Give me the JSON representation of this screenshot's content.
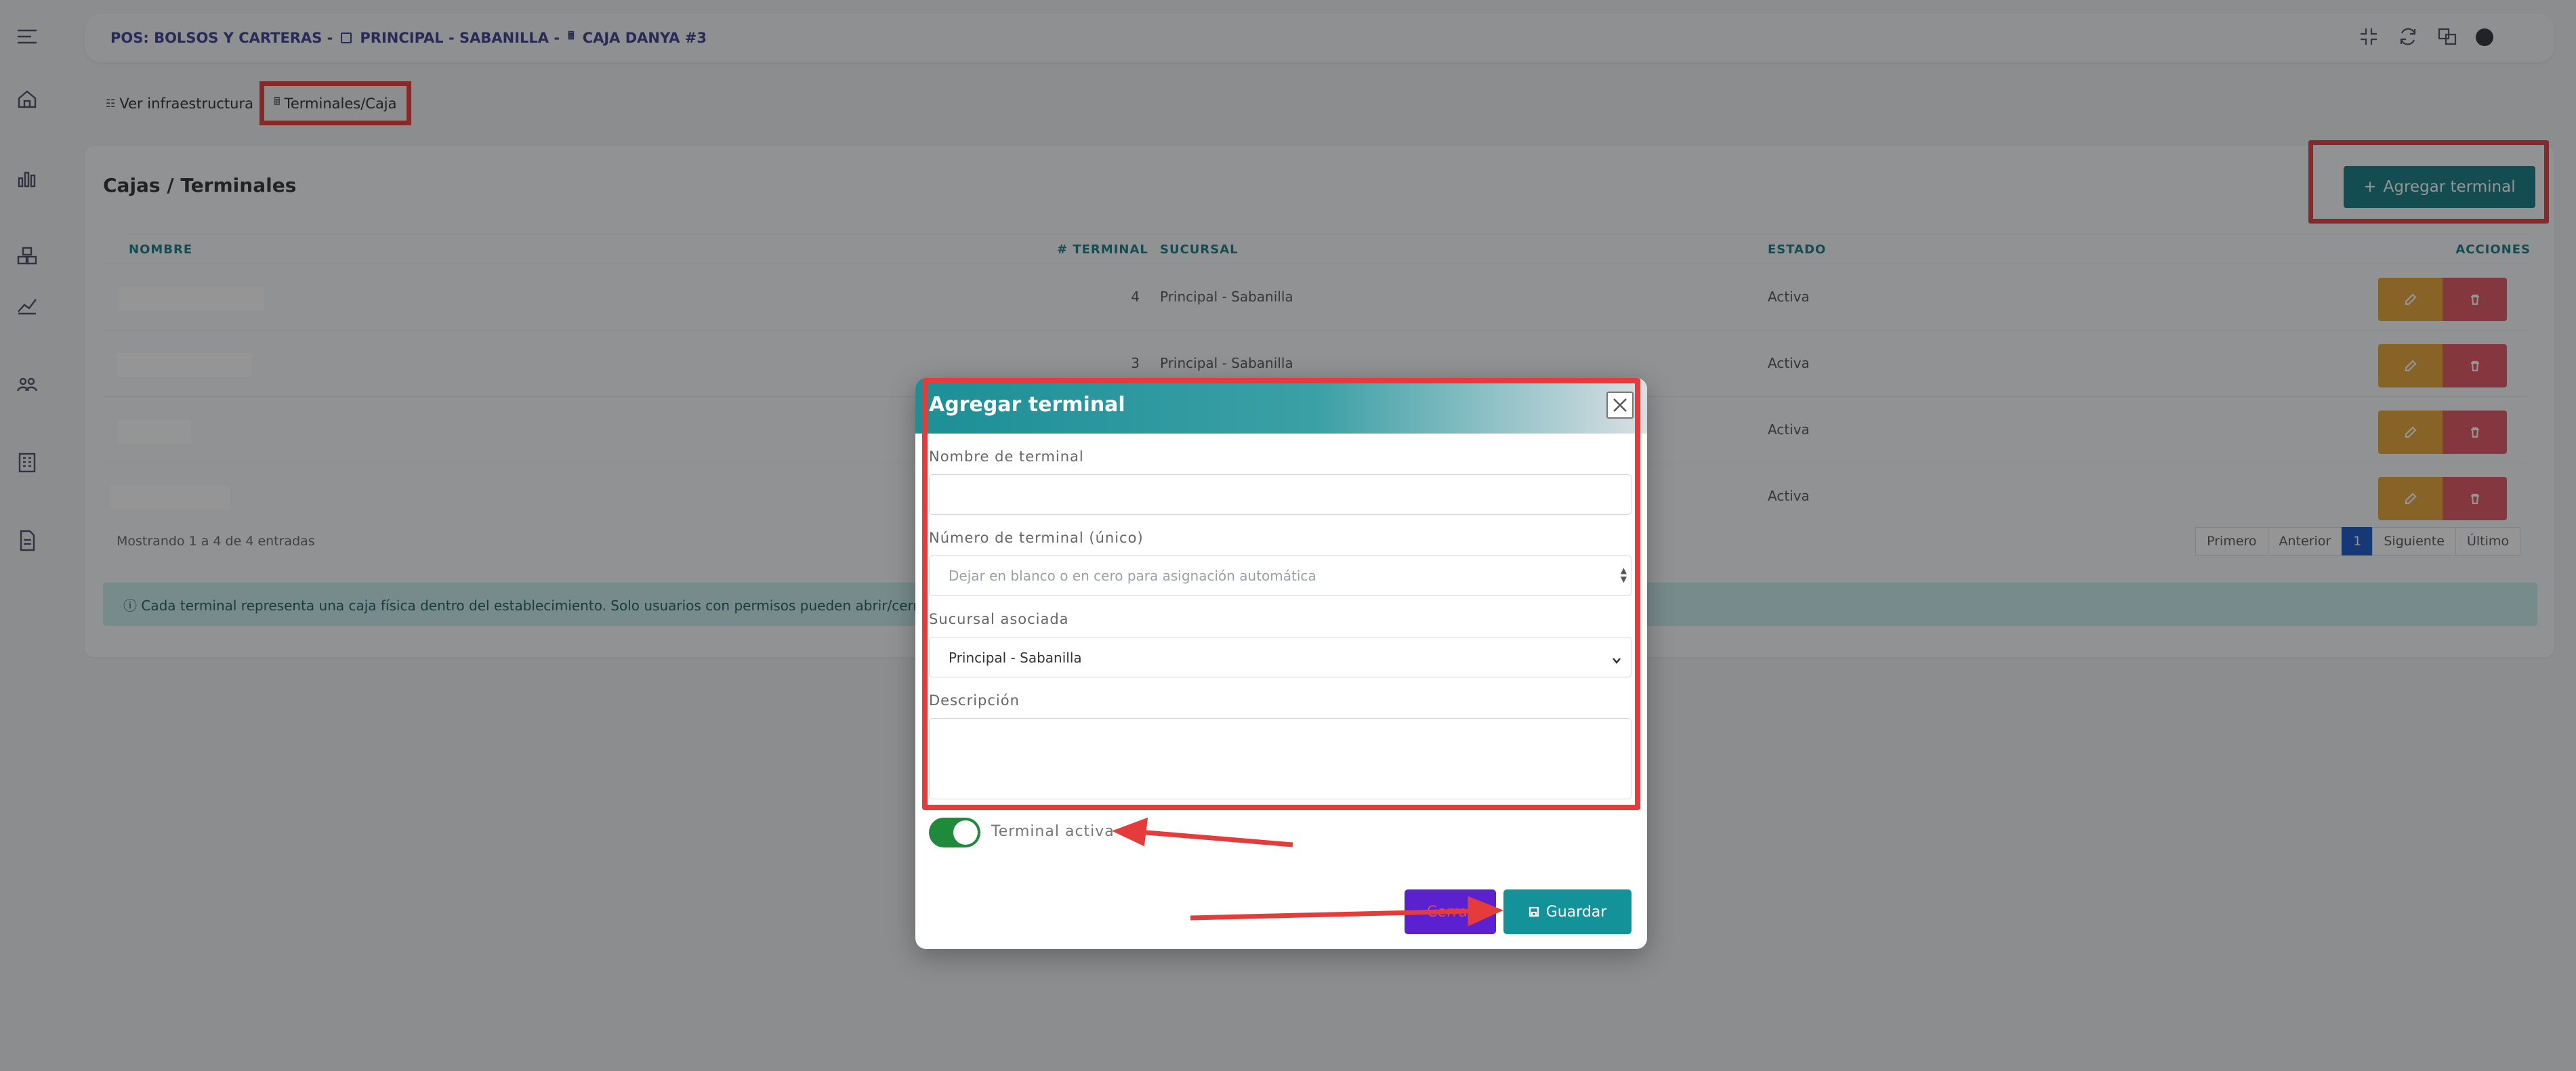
{
  "breadcrumb": {
    "part1": "POS: BOLSOS Y CARTERAS -",
    "part2": "PRINCIPAL - SABANILLA -",
    "part3": "CAJA DANYA #3"
  },
  "tabs": [
    {
      "label": "Ver infraestructura"
    },
    {
      "label": "Terminales/Caja"
    }
  ],
  "card": {
    "title": "Cajas / Terminales",
    "add_button": "Agregar terminal"
  },
  "table": {
    "headers": {
      "nombre": "NOMBRE",
      "terminal": "# TERMINAL",
      "sucursal": "SUCURSAL",
      "estado": "ESTADO",
      "acciones": "ACCIONES"
    },
    "rows": [
      {
        "terminal": "4",
        "sucursal": "Principal - Sabanilla",
        "estado": "Activa"
      },
      {
        "terminal": "3",
        "sucursal": "Principal - Sabanilla",
        "estado": "Activa"
      },
      {
        "terminal": "",
        "sucursal": "",
        "estado": "Activa"
      },
      {
        "terminal": "",
        "sucursal": "",
        "estado": "Activa"
      }
    ],
    "showing": "Mostrando 1 a 4 de 4 entradas",
    "pager": [
      "Primero",
      "Anterior",
      "1",
      "Siguiente",
      "Último"
    ]
  },
  "info_text": "ⓘ Cada terminal representa una caja física dentro del establecimiento. Solo usuarios con permisos pueden abrir/cerrar u",
  "modal": {
    "title": "Agregar terminal",
    "name_label": "Nombre de terminal",
    "name_value": "",
    "number_label": "Número de terminal (único)",
    "number_placeholder": "Dejar en blanco o en cero para asignación automática",
    "branch_label": "Sucursal asociada",
    "branch_value": "Principal - Sabanilla",
    "desc_label": "Descripción",
    "toggle_label": "Terminal activa",
    "toggle_on": true,
    "close_button": "Cerrar",
    "save_button": "Guardar"
  },
  "colors": {
    "accent": "#137d86",
    "highlight": "#e63b3b",
    "edit": "#e6a53a",
    "delete": "#e05561",
    "toggle": "#1f8a3b",
    "close_btn": "#5b21d1"
  }
}
